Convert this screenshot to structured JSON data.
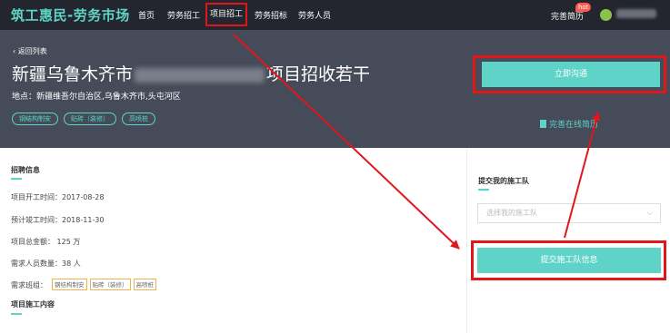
{
  "nav": {
    "logo": "筑工惠民-劳务市场",
    "items": [
      "首页",
      "劳务招工",
      "项目招工",
      "劳务招标",
      "劳务人员"
    ],
    "resume": "完善简历",
    "hot_badge": "hot"
  },
  "header": {
    "back": "返回列表",
    "title_prefix": "新疆乌鲁木齐市",
    "title_suffix": "项目招收若干",
    "location": "地点：新疆维吾尔自治区,乌鲁木齐市,头屯河区",
    "tags": [
      "钢结构制安",
      "贴砖（装修）",
      "高喷桩"
    ],
    "contact_button": "立即沟通",
    "resume_link": "完善在线简历"
  },
  "recruit": {
    "section_title": "招聘信息",
    "rows": [
      "项目开工时间：2017-08-28",
      "预计竣工时间：2018-11-30",
      "项目总金额：  125 万",
      "需求人员数量：38 人"
    ],
    "crew_label": "需求班组：",
    "crew_tags": [
      "钢结构制安",
      "贴砖（装修）",
      "高喷桩"
    ],
    "content_title": "项目施工内容"
  },
  "submit": {
    "section_title": "提交我的施工队",
    "select_placeholder": "选择我的施工队",
    "submit_button": "提交施工队信息"
  },
  "colors": {
    "accent": "#5fd3c7",
    "navbar": "#23262e",
    "header": "#454b58",
    "highlight": "#e0161b"
  }
}
